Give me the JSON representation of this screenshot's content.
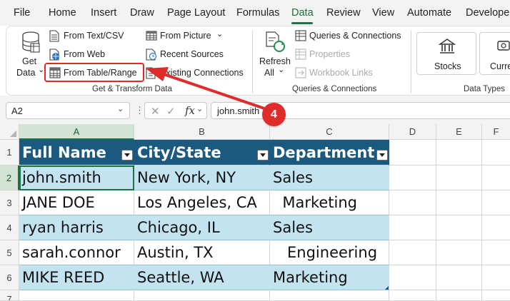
{
  "menu": {
    "items": [
      "File",
      "Home",
      "Insert",
      "Draw",
      "Page Layout",
      "Formulas",
      "Data",
      "Review",
      "View",
      "Automate",
      "Developer"
    ],
    "active": "Data"
  },
  "ribbon": {
    "get_data": {
      "line1": "Get",
      "line2": "Data",
      "chevron": "⌄"
    },
    "from_text_csv": "From Text/CSV",
    "from_web": "From Web",
    "from_table_range": "From Table/Range",
    "from_picture": "From Picture",
    "recent_sources": "Recent Sources",
    "existing_connections": "Existing Connections",
    "get_transform_label": "Get & Transform Data",
    "refresh": {
      "line1": "Refresh",
      "line2": "All"
    },
    "queries_connections": "Queries & Connections",
    "properties": "Properties",
    "workbook_links": "Workbook Links",
    "queries_group_label": "Queries & Connections",
    "stocks": "Stocks",
    "currencies": "Currenc",
    "data_types_label": "Data Types"
  },
  "formula_bar": {
    "name_box": "A2",
    "fx": "fx",
    "value": "john.smith"
  },
  "callout": {
    "number": "4"
  },
  "grid": {
    "columns": [
      "A",
      "B",
      "C",
      "D",
      "E",
      "F"
    ],
    "rows": [
      "1",
      "2",
      "3",
      "4",
      "5",
      "6",
      "7"
    ],
    "table_headers": [
      "Full Name",
      "City/State",
      "Department"
    ],
    "table_rows": [
      [
        "john.smith",
        "New York, NY",
        "Sales"
      ],
      [
        "JANE DOE",
        "Los Angeles, CA",
        "  Marketing"
      ],
      [
        "ryan harris",
        "Chicago, IL",
        "Sales"
      ],
      [
        "sarah.connor",
        "Austin, TX",
        "   Engineering"
      ],
      [
        "MIKE REED",
        "Seattle, WA",
        "Marketing"
      ]
    ]
  },
  "colors": {
    "accent": "#1e7145",
    "table_header": "#1b5a7e",
    "band": "#c4e3f1",
    "callout": "#e02b2b"
  },
  "icons": [
    "database-icon",
    "text-file-icon",
    "web-icon",
    "table-icon",
    "picture-icon",
    "recent-sources-icon",
    "connections-icon",
    "refresh-icon",
    "queries-icon",
    "properties-icon",
    "links-icon",
    "stocks-icon",
    "currency-icon"
  ]
}
